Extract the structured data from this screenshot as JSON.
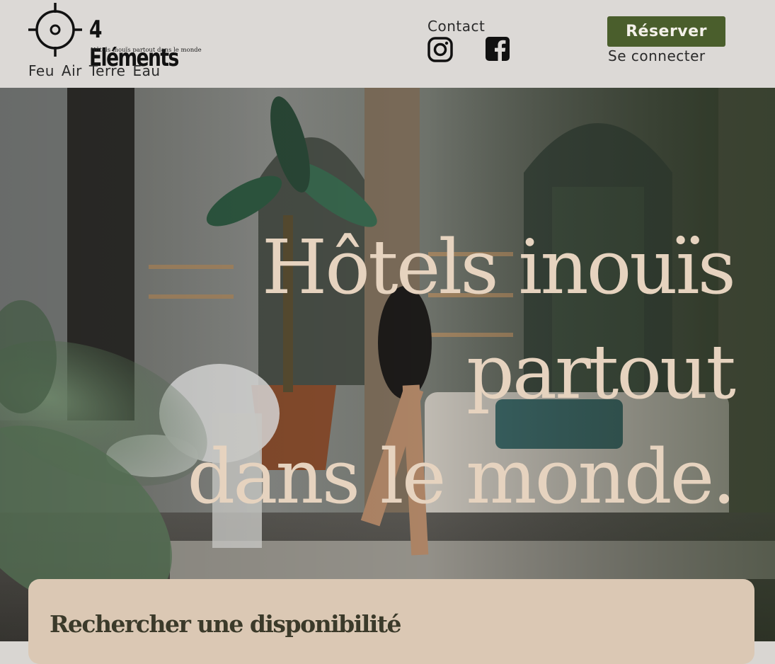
{
  "brand": {
    "wordmark": "4 Eléments",
    "tagline": "Hôtels inouïs partout dans le monde",
    "icon": "target-crosshair-icon"
  },
  "elements_nav": [
    "Feu",
    "Air",
    "Terre",
    "Eau"
  ],
  "header": {
    "contact_label": "Contact",
    "social": [
      "instagram-icon",
      "facebook-icon"
    ],
    "reserve_label": "Réserver",
    "login_label": "Se connecter"
  },
  "hero": {
    "title_lines": [
      "Hôtels inouïs",
      "partout",
      "dans le monde."
    ]
  },
  "search": {
    "title": "Rechercher une disponibilité"
  },
  "colors": {
    "header_bg": "#dcd9d6",
    "accent_green": "#4a5e2c",
    "hero_text": "#e6d3bf",
    "card_bg": "#dbc8b4",
    "text_dark": "#2b2b2b"
  }
}
